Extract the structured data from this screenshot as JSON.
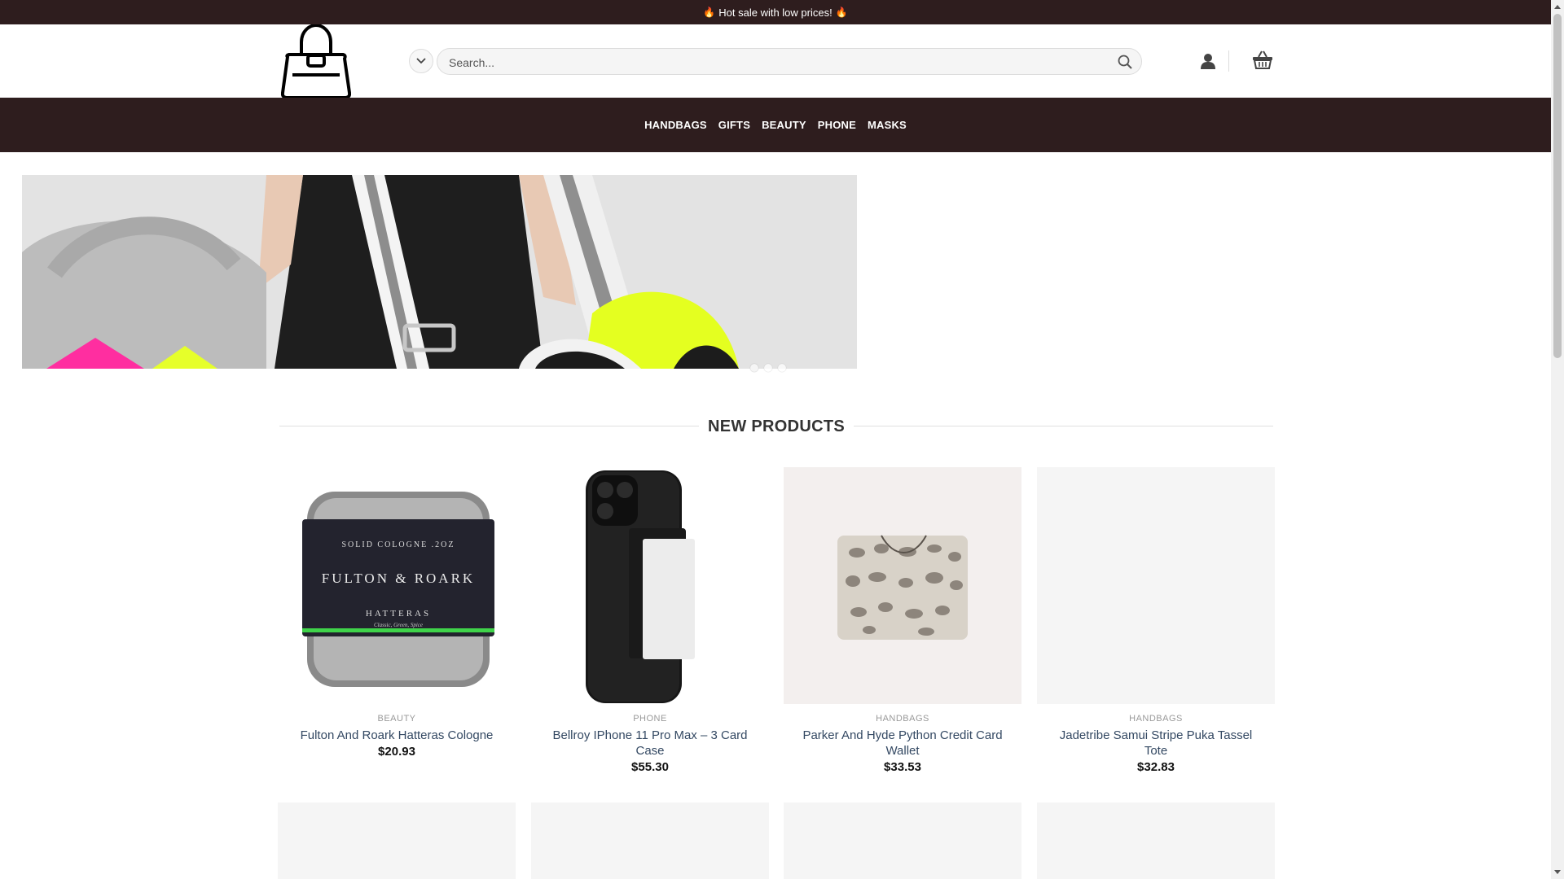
{
  "topbar": {
    "text": "Hot sale with low prices!"
  },
  "header": {
    "search_placeholder": "Search..."
  },
  "nav": {
    "items": [
      "HANDBAGS",
      "GIFTS",
      "BEAUTY",
      "PHONE",
      "MASKS"
    ]
  },
  "hero": {
    "slides": 3,
    "active_slide": 1
  },
  "section": {
    "title": "NEW PRODUCTS"
  },
  "products": [
    {
      "category": "BEAUTY",
      "name": "Fulton And Roark Hatteras Cologne",
      "price": "$20.93",
      "label_top": "SOLID COLOGNE .2OZ",
      "label_brand": "FULTON & ROARK",
      "label_name": "HATTERAS",
      "label_sub": "Classic, Green, Spice"
    },
    {
      "category": "PHONE",
      "name": "Bellroy IPhone 11 Pro Max – 3 Card Case",
      "price": "$55.30"
    },
    {
      "category": "HANDBAGS",
      "name": "Parker And Hyde Python Credit Card Wallet",
      "price": "$33.53"
    },
    {
      "category": "HANDBAGS",
      "name": "Jadetribe Samui Stripe Puka Tassel Tote",
      "price": "$32.83"
    }
  ],
  "colors": {
    "brand_dark": "#2e1d1e",
    "link": "#334862"
  }
}
